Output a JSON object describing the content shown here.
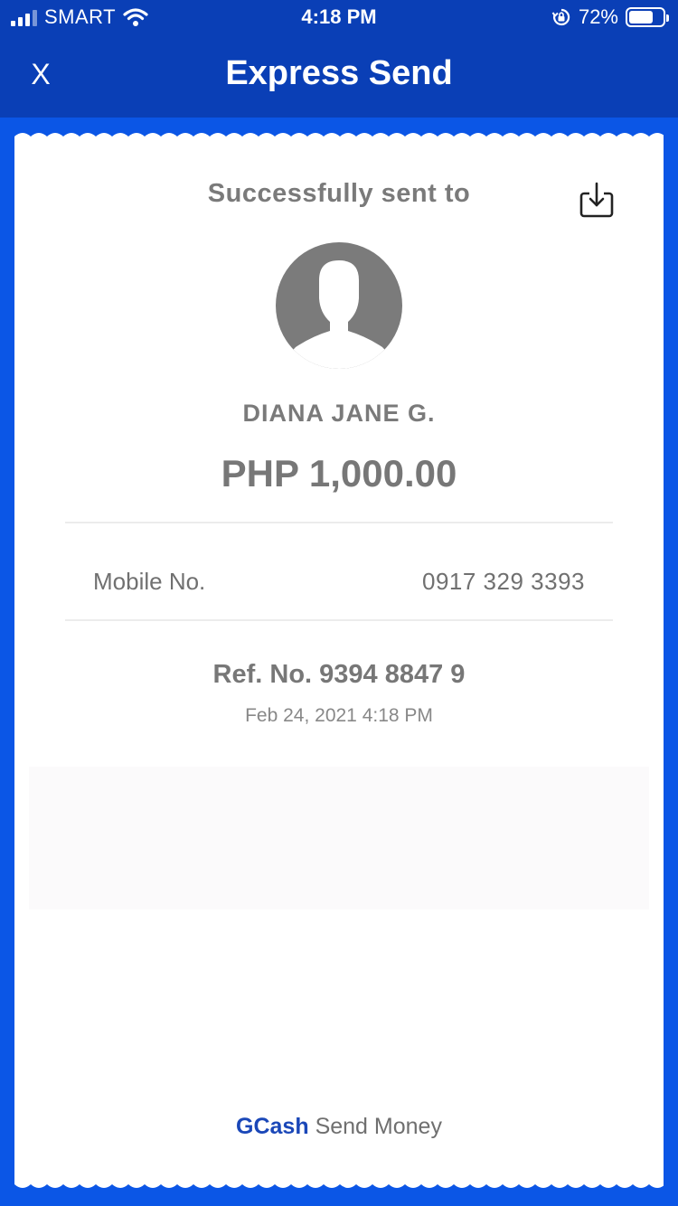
{
  "status_bar": {
    "carrier": "SMART",
    "time": "4:18 PM",
    "battery_percent": "72%",
    "battery_level": 0.72,
    "icons": [
      "signal-bars-icon",
      "wifi-icon",
      "orientation-lock-icon",
      "battery-icon"
    ]
  },
  "header": {
    "close_label": "X",
    "title": "Express Send"
  },
  "receipt": {
    "success_text": "Successfully sent to",
    "recipient_name": "DIANA JANE G.",
    "amount": "PHP 1,000.00",
    "mobile_label": "Mobile No.",
    "mobile_value": "0917 329 3393",
    "ref_no": "Ref. No. 9394 8847 9",
    "datetime": "Feb 24, 2021 4:18 PM",
    "download_icon": "download-icon",
    "avatar_icon": "avatar-placeholder-icon"
  },
  "footer": {
    "brand": "GCash",
    "suffix": "Send Money"
  },
  "colors": {
    "background_blue": "#0b56e6",
    "header_blue": "#0a3fb6",
    "brand_blue": "#1a47b8",
    "text_gray": "#7a7a7a"
  }
}
